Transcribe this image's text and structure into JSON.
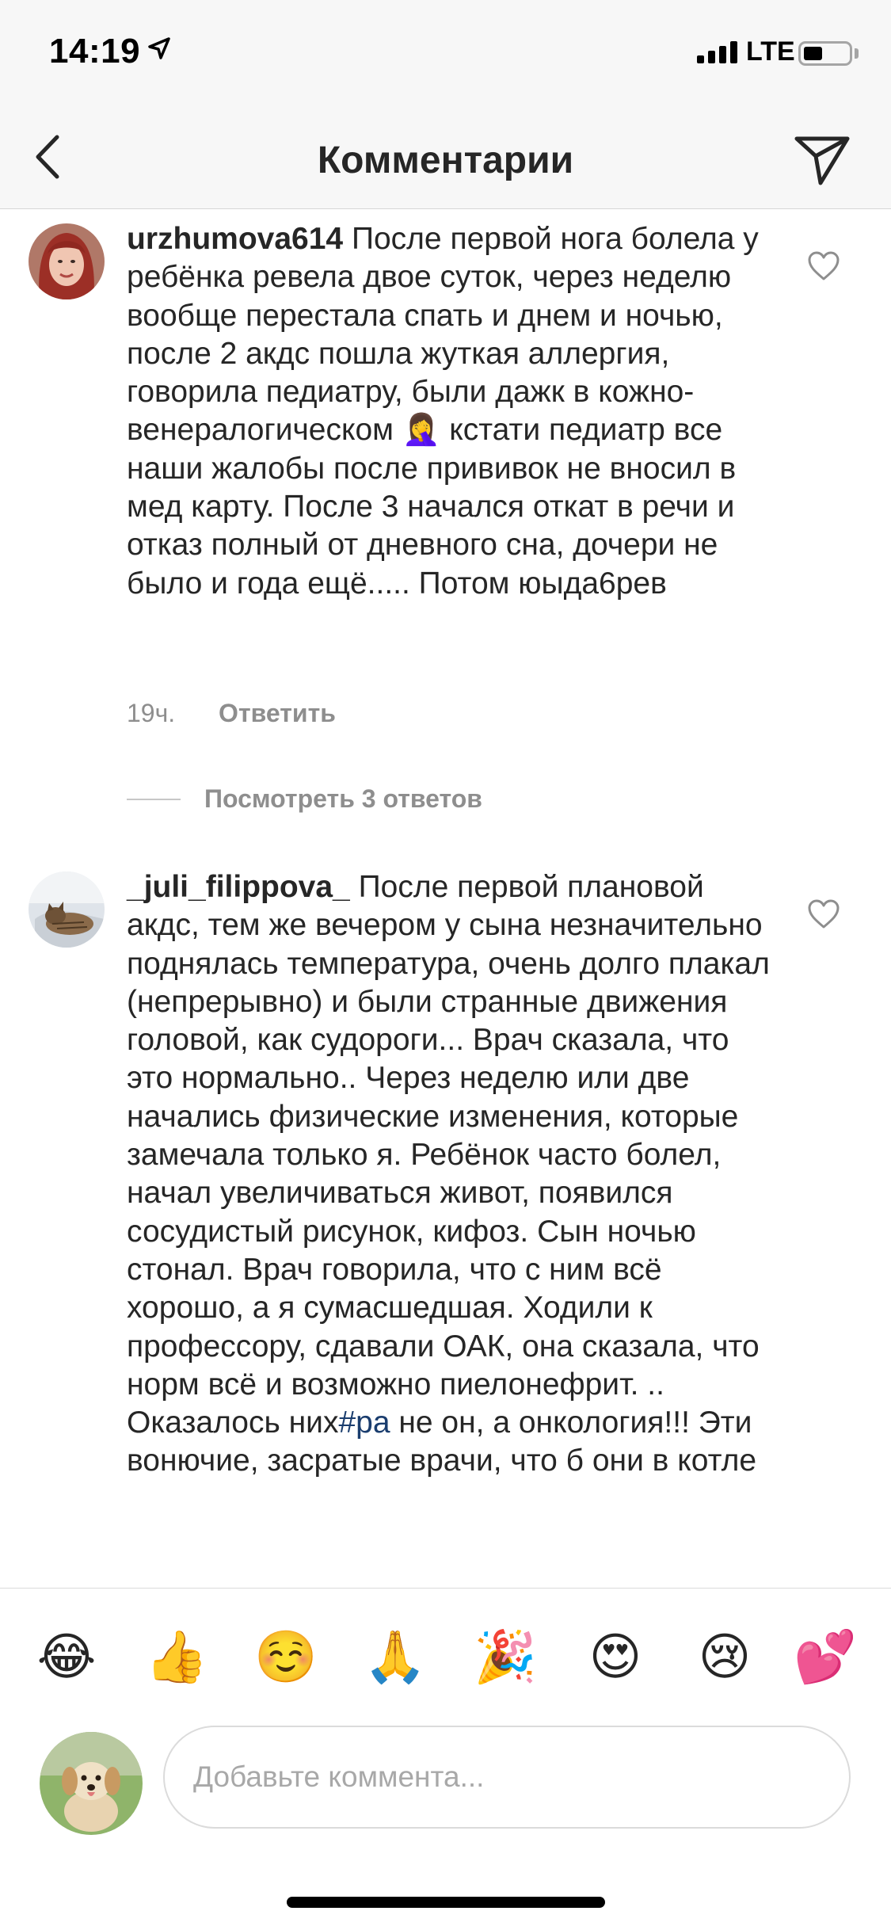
{
  "status_bar": {
    "time": "14:19",
    "network": "LTE"
  },
  "header": {
    "title": "Комментарии"
  },
  "comments": [
    {
      "username": "urzhumova614",
      "text_a": "После первой нога болела у ребёнка ревела двое суток, через неделю вообще перестала спать и днем и ночью, после 2 акдс пошла жуткая аллергия, говорила педиатру, были дажк в кожно-венералогическом ",
      "emoji": "🤦‍♀️",
      "text_b": " кстати педиатр все наши жалобы после прививок не вносил в мед карту. После 3 начался откат в речи и отказ полный от дневного сна, дочери не было и года ещё..... Потом юыда6рев",
      "time": "19ч.",
      "reply_label": "Ответить",
      "view_replies": "Посмотреть 3 ответов"
    },
    {
      "username": "_juli_filippova_",
      "text_a": "После первой плановой акдс, тем же вечером у сына незначительно поднялась температура, очень долго плакал (непрерывно) и были странные движения головой, как судороги... Врач сказала, что это нормально.. Через неделю или две начались физические изменения, которые замечала только я. Ребёнок часто болел, начал увеличиваться живот, появился сосудистый рисунок, кифоз. Сын ночью стонал. Врач говорила, что с ним всё хорошо, а я сумасшедшая. Ходили к профессору, сдавали ОАК, она сказала, что норм всё и возможно пиелонефрит. .. Оказалось них",
      "hashtag": "#ра",
      "text_b": " не он, а онкология!!! Эти вонючие, засратые врачи, что б они в котле"
    }
  ],
  "emoji_bar": [
    {
      "char": "😂",
      "name": "laughing-emoji"
    },
    {
      "char": "👍",
      "name": "thumbs-up-emoji"
    },
    {
      "char": "☺️",
      "name": "smiling-emoji"
    },
    {
      "char": "🙏",
      "name": "pray-emoji"
    },
    {
      "char": "🎉",
      "name": "party-popper-emoji"
    },
    {
      "char": "😍",
      "name": "heart-eyes-emoji"
    },
    {
      "char": "😢",
      "name": "crying-emoji"
    },
    {
      "char": "💕",
      "name": "two-hearts-emoji"
    }
  ],
  "composer": {
    "placeholder": "Добавьте коммента..."
  }
}
